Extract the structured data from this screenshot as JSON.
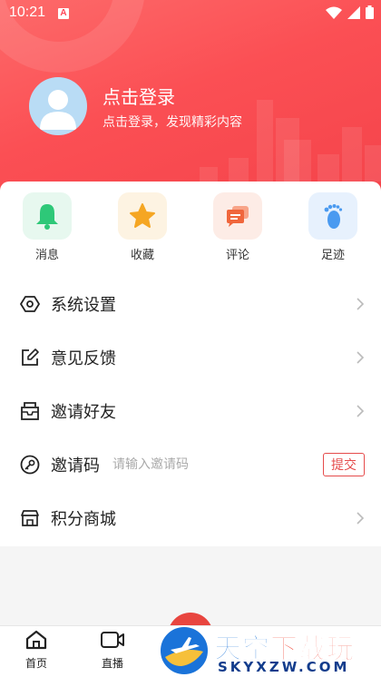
{
  "status_bar": {
    "time": "10:21",
    "badge": "A"
  },
  "profile": {
    "title": "点击登录",
    "subtitle": "点击登录，发现精彩内容"
  },
  "quick_actions": [
    {
      "label": "消息",
      "icon": "bell-icon",
      "color": "#2ec878"
    },
    {
      "label": "收藏",
      "icon": "star-icon",
      "color": "#f5a623"
    },
    {
      "label": "评论",
      "icon": "comment-icon",
      "color": "#f0663c"
    },
    {
      "label": "足迹",
      "icon": "footprint-icon",
      "color": "#4a9af0"
    }
  ],
  "menu": {
    "settings": "系统设置",
    "feedback": "意见反馈",
    "invite_friends": "邀请好友",
    "invite_code": "邀请码",
    "invite_placeholder": "请输入邀请码",
    "submit": "提交",
    "points_mall": "积分商城"
  },
  "tabs": {
    "home": "首页",
    "live": "直播"
  },
  "watermark": {
    "brand_blue": "天空",
    "brand_red": "下载玩",
    "domain": "SKYXZW.COM"
  },
  "colors": {
    "header": "#fb4f54",
    "accent": "#e54b4b"
  }
}
